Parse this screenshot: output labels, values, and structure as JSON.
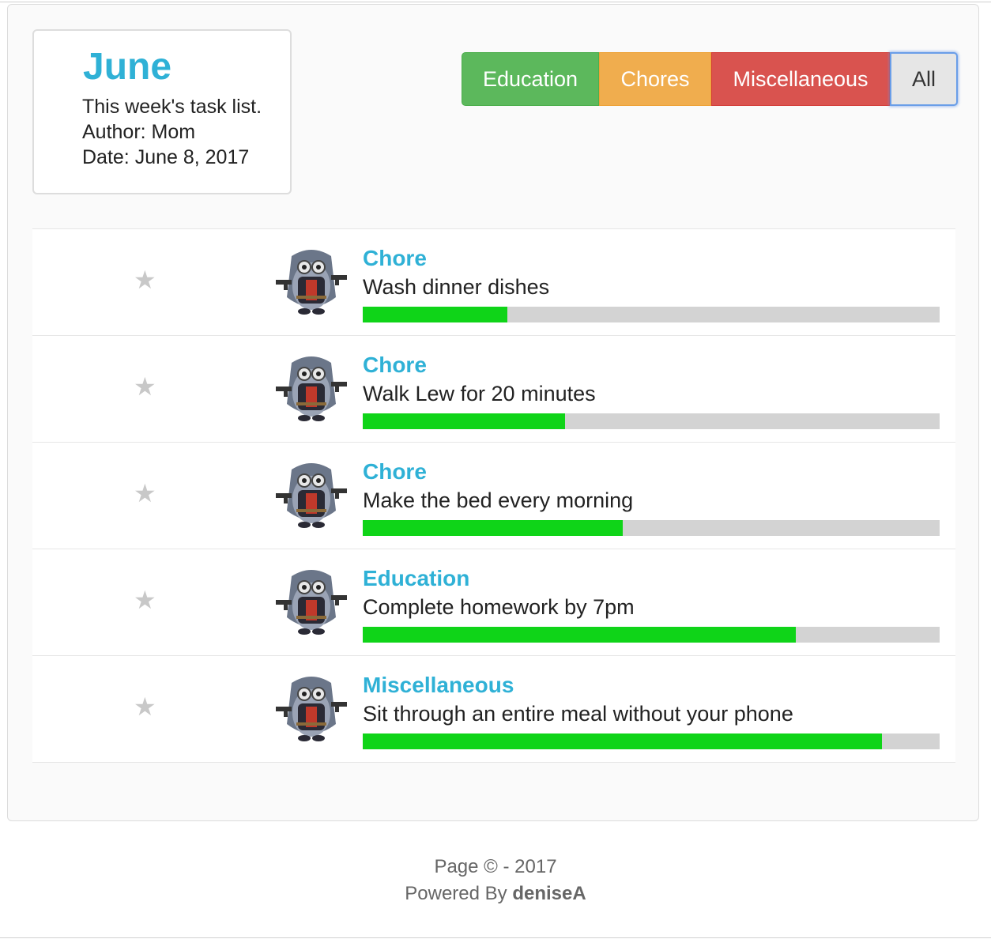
{
  "info": {
    "title": "June",
    "description": "This week's task list.",
    "author": "Author: Mom",
    "date": "Date: June 8, 2017"
  },
  "filters": [
    {
      "label": "Education",
      "color": "#5cb85c"
    },
    {
      "label": "Chores",
      "color": "#f0ad4e"
    },
    {
      "label": "Miscellaneous",
      "color": "#d9534f"
    },
    {
      "label": "All",
      "color": "#e6e6e6",
      "active": true
    }
  ],
  "tasks": [
    {
      "category": "Chore",
      "name": "Wash dinner dishes",
      "progress": 0.25,
      "icon": "star-icon",
      "avatar": "minion-avatar"
    },
    {
      "category": "Chore",
      "name": "Walk Lew for 20 minutes",
      "progress": 0.35,
      "icon": "star-icon",
      "avatar": "minion-avatar"
    },
    {
      "category": "Chore",
      "name": "Make the bed every morning",
      "progress": 0.45,
      "icon": "star-icon",
      "avatar": "minion-avatar"
    },
    {
      "category": "Education",
      "name": "Complete homework by 7pm",
      "progress": 0.75,
      "icon": "star-icon",
      "avatar": "minion-avatar"
    },
    {
      "category": "Miscellaneous",
      "name": "Sit through an entire meal without your phone",
      "progress": 0.9,
      "icon": "star-icon",
      "avatar": "minion-avatar"
    }
  ],
  "colors": {
    "accent": "#2fb1d6",
    "progress_fill": "#0fd418",
    "progress_track": "#d3d3d3"
  },
  "footer": {
    "copyright": "Page © - 2017",
    "powered_prefix": "Powered By ",
    "powered_author": "deniseA"
  }
}
